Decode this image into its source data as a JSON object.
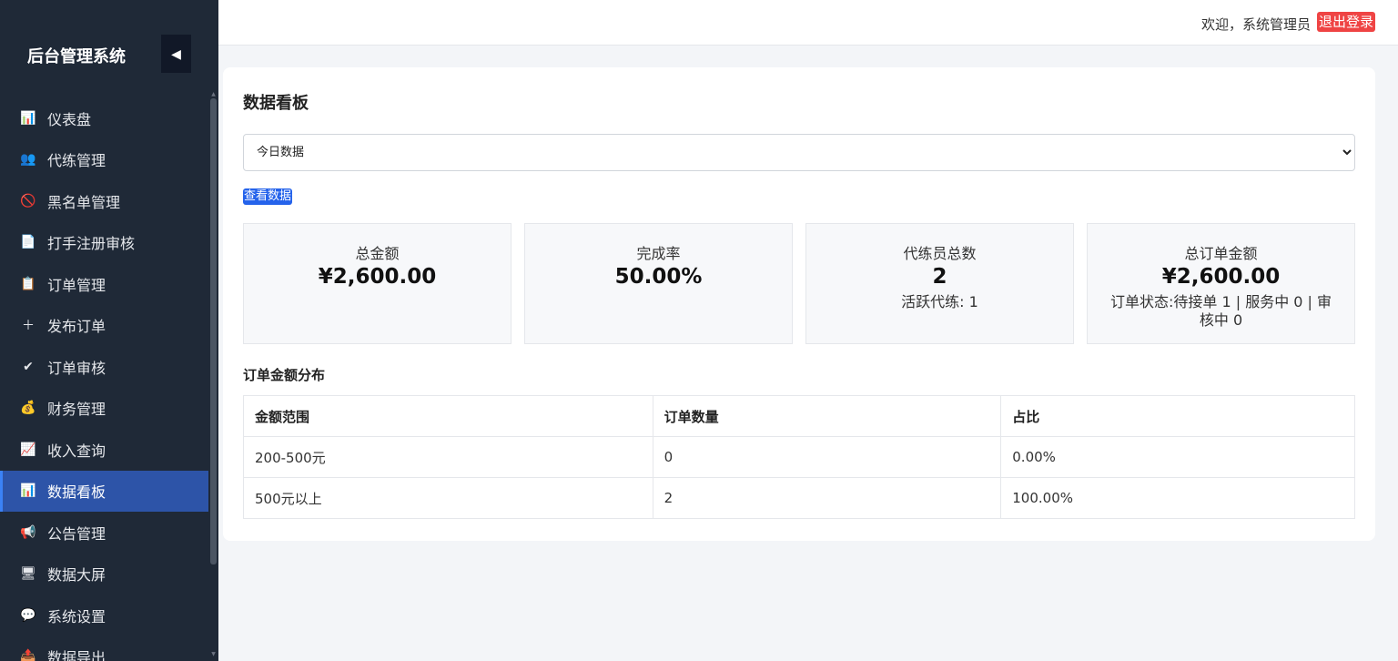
{
  "sidebar": {
    "title": "后台管理系统",
    "collapse_icon": "◀",
    "items": [
      {
        "label": "仪表盘",
        "icon": "📊",
        "icon_name": "bar-chart-icon"
      },
      {
        "label": "代练管理",
        "icon": "👥",
        "icon_name": "users-icon"
      },
      {
        "label": "黑名单管理",
        "icon": "🚫",
        "icon_name": "prohibited-icon"
      },
      {
        "label": "打手注册审核",
        "icon": "📄",
        "icon_name": "document-icon"
      },
      {
        "label": "订单管理",
        "icon": "📋",
        "icon_name": "clipboard-icon"
      },
      {
        "label": "发布订单",
        "icon": "＋",
        "icon_name": "plus-icon"
      },
      {
        "label": "订单审核",
        "icon": "✔",
        "icon_name": "check-icon"
      },
      {
        "label": "财务管理",
        "icon": "💰",
        "icon_name": "money-bag-icon"
      },
      {
        "label": "收入查询",
        "icon": "📈",
        "icon_name": "line-chart-icon"
      },
      {
        "label": "数据看板",
        "icon": "📊",
        "icon_name": "bar-chart-icon",
        "active": true
      },
      {
        "label": "公告管理",
        "icon": "📢",
        "icon_name": "megaphone-icon"
      },
      {
        "label": "数据大屏",
        "icon": "🖥",
        "icon_name": "monitor-icon"
      },
      {
        "label": "系统设置",
        "icon": "💬",
        "icon_name": "speech-bubble-icon"
      },
      {
        "label": "数据导出",
        "icon": "📤",
        "icon_name": "export-icon"
      }
    ]
  },
  "header": {
    "welcome": "欢迎，系统管理员",
    "logout_label": "退出登录"
  },
  "main": {
    "title": "数据看板",
    "range_select": {
      "selected": "今日数据"
    },
    "view_button": "查看数据",
    "stats": [
      {
        "label": "总金额",
        "value": "¥2,600.00",
        "sub": ""
      },
      {
        "label": "完成率",
        "value": "50.00%",
        "sub": ""
      },
      {
        "label": "代练员总数",
        "value": "2",
        "sub": "活跃代练: 1"
      },
      {
        "label": "总订单金额",
        "value": "¥2,600.00",
        "sub": "订单状态:待接单 1 | 服务中 0 | 审核中 0"
      }
    ],
    "distribution": {
      "title": "订单金额分布",
      "headers": [
        "金额范围",
        "订单数量",
        "占比"
      ],
      "rows": [
        [
          "200-500元",
          "0",
          "0.00%"
        ],
        [
          "500元以上",
          "2",
          "100.00%"
        ]
      ]
    }
  },
  "colors": {
    "sidebar_bg": "#1f2937",
    "active_item_bg": "#2d54a8",
    "logout_bg": "#ef4444",
    "primary_button": "#2563eb"
  }
}
